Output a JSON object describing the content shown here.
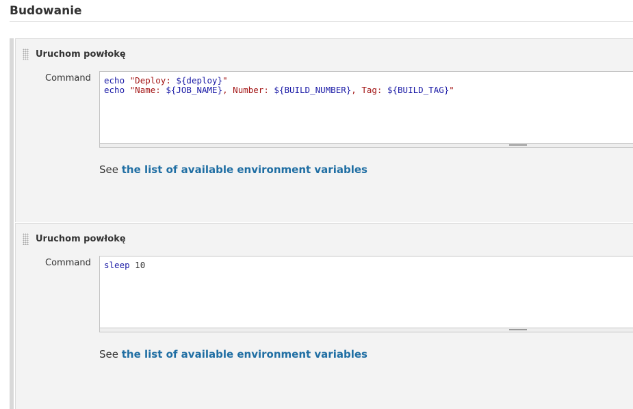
{
  "section": {
    "title": "Budowanie"
  },
  "steps": [
    {
      "title": "Uruchom powłokę",
      "command_label": "Command",
      "command_lines": [
        "echo \"Deploy: ${deploy}\"",
        "echo \"Name: ${JOB_NAME}, Number: ${BUILD_NUMBER}, Tag: ${BUILD_TAG}\""
      ],
      "help_prefix": "See",
      "help_link": "the list of available environment variables"
    },
    {
      "title": "Uruchom powłokę",
      "command_label": "Command",
      "command_lines": [
        "sleep 10"
      ],
      "help_prefix": "See",
      "help_link": "the list of available environment variables"
    }
  ],
  "colors": {
    "keyword": "#1a1aa6",
    "string": "#a31515",
    "link": "#1f6ea3",
    "panel_bg": "#f3f3f3"
  },
  "icons": {
    "drag_handle": "drag-grip-icon",
    "resize": "resize-grip-icon"
  }
}
